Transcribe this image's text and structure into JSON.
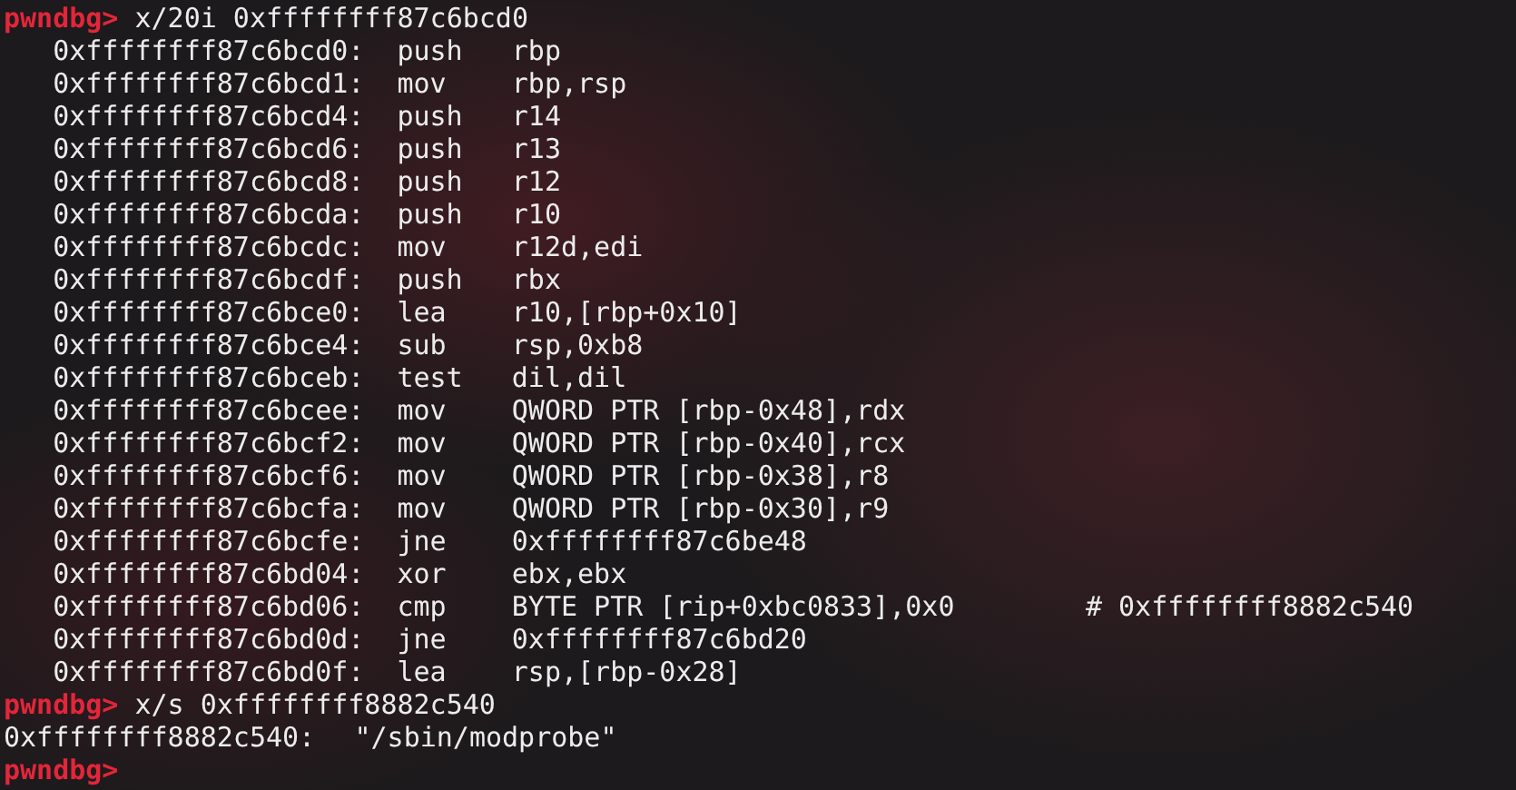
{
  "lines": [
    {
      "kind": "prompt",
      "prompt": "pwndbg>",
      "command": "x/20i 0xffffffff87c6bcd0"
    },
    {
      "kind": "instruction",
      "address": "0xffffffff87c6bcd0:",
      "mnemonic": "push",
      "operands": "rbp"
    },
    {
      "kind": "instruction",
      "address": "0xffffffff87c6bcd1:",
      "mnemonic": "mov",
      "operands": "rbp,rsp"
    },
    {
      "kind": "instruction",
      "address": "0xffffffff87c6bcd4:",
      "mnemonic": "push",
      "operands": "r14"
    },
    {
      "kind": "instruction",
      "address": "0xffffffff87c6bcd6:",
      "mnemonic": "push",
      "operands": "r13"
    },
    {
      "kind": "instruction",
      "address": "0xffffffff87c6bcd8:",
      "mnemonic": "push",
      "operands": "r12"
    },
    {
      "kind": "instruction",
      "address": "0xffffffff87c6bcda:",
      "mnemonic": "push",
      "operands": "r10"
    },
    {
      "kind": "instruction",
      "address": "0xffffffff87c6bcdc:",
      "mnemonic": "mov",
      "operands": "r12d,edi"
    },
    {
      "kind": "instruction",
      "address": "0xffffffff87c6bcdf:",
      "mnemonic": "push",
      "operands": "rbx"
    },
    {
      "kind": "instruction",
      "address": "0xffffffff87c6bce0:",
      "mnemonic": "lea",
      "operands": "r10,[rbp+0x10]"
    },
    {
      "kind": "instruction",
      "address": "0xffffffff87c6bce4:",
      "mnemonic": "sub",
      "operands": "rsp,0xb8"
    },
    {
      "kind": "instruction",
      "address": "0xffffffff87c6bceb:",
      "mnemonic": "test",
      "operands": "dil,dil"
    },
    {
      "kind": "instruction",
      "address": "0xffffffff87c6bcee:",
      "mnemonic": "mov",
      "operands": "QWORD PTR [rbp-0x48],rdx"
    },
    {
      "kind": "instruction",
      "address": "0xffffffff87c6bcf2:",
      "mnemonic": "mov",
      "operands": "QWORD PTR [rbp-0x40],rcx"
    },
    {
      "kind": "instruction",
      "address": "0xffffffff87c6bcf6:",
      "mnemonic": "mov",
      "operands": "QWORD PTR [rbp-0x38],r8"
    },
    {
      "kind": "instruction",
      "address": "0xffffffff87c6bcfa:",
      "mnemonic": "mov",
      "operands": "QWORD PTR [rbp-0x30],r9"
    },
    {
      "kind": "instruction",
      "address": "0xffffffff87c6bcfe:",
      "mnemonic": "jne",
      "operands": "0xffffffff87c6be48"
    },
    {
      "kind": "instruction",
      "address": "0xffffffff87c6bd04:",
      "mnemonic": "xor",
      "operands": "ebx,ebx"
    },
    {
      "kind": "instruction",
      "address": "0xffffffff87c6bd06:",
      "mnemonic": "cmp",
      "operands": "BYTE PTR [rip+0xbc0833],0x0",
      "comment": "# 0xffffffff8882c540"
    },
    {
      "kind": "instruction",
      "address": "0xffffffff87c6bd0d:",
      "mnemonic": "jne",
      "operands": "0xffffffff87c6bd20"
    },
    {
      "kind": "instruction",
      "address": "0xffffffff87c6bd0f:",
      "mnemonic": "lea",
      "operands": "rsp,[rbp-0x28]"
    },
    {
      "kind": "prompt",
      "prompt": "pwndbg>",
      "command": "x/s 0xffffffff8882c540"
    },
    {
      "kind": "output",
      "address": "0xffffffff8882c540:",
      "value": "\"/sbin/modprobe\""
    },
    {
      "kind": "prompt",
      "prompt": "pwndbg>"
    }
  ]
}
